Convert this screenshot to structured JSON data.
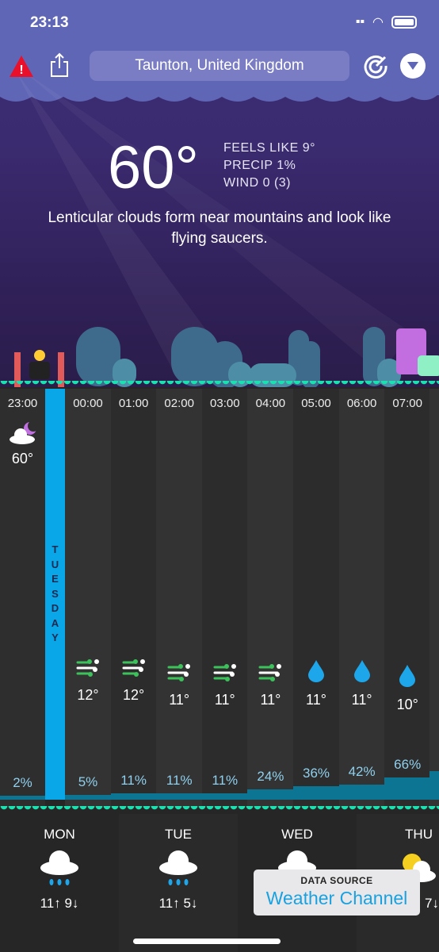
{
  "status": {
    "time": "23:13"
  },
  "header": {
    "location": "Taunton, United Kingdom",
    "icons": [
      "alert-icon",
      "share-icon",
      "radar-icon",
      "dropdown-icon"
    ]
  },
  "current": {
    "temp": "60°",
    "feels_like": "FEELS LIKE 9°",
    "precip": "PRECIP 1%",
    "wind": "WIND 0 (3)",
    "fact": "Lenticular clouds form near mountains and look like flying saucers."
  },
  "hourly": {
    "day_marker": "TUESDAY",
    "now": {
      "time": "23:00",
      "icon": "moon-cloud-icon",
      "temp": "60°",
      "precip": "2%",
      "precip_value": 2
    },
    "hours": [
      {
        "time": "00:00",
        "icon": "wind-icon",
        "temp": "12°",
        "precip": "5%",
        "precip_value": 5
      },
      {
        "time": "01:00",
        "icon": "wind-icon",
        "temp": "12°",
        "precip": "11%",
        "precip_value": 11
      },
      {
        "time": "02:00",
        "icon": "wind-icon",
        "temp": "11°",
        "precip": "11%",
        "precip_value": 11
      },
      {
        "time": "03:00",
        "icon": "wind-icon",
        "temp": "11°",
        "precip": "11%",
        "precip_value": 11
      },
      {
        "time": "04:00",
        "icon": "wind-icon",
        "temp": "11°",
        "precip": "24%",
        "precip_value": 24
      },
      {
        "time": "05:00",
        "icon": "raindrop-icon",
        "temp": "11°",
        "precip": "36%",
        "precip_value": 36
      },
      {
        "time": "06:00",
        "icon": "raindrop-icon",
        "temp": "11°",
        "precip": "42%",
        "precip_value": 42
      },
      {
        "time": "07:00",
        "icon": "raindrop-icon",
        "temp": "10°",
        "precip": "66%",
        "precip_value": 66
      }
    ]
  },
  "daily": [
    {
      "day": "MON",
      "icon": "rain-cloud-icon",
      "temps": "11↑ 9↓"
    },
    {
      "day": "TUE",
      "icon": "rain-cloud-icon",
      "temps": "11↑ 5↓"
    },
    {
      "day": "WED",
      "icon": "rain-cloud-icon",
      "temps": ""
    },
    {
      "day": "THU",
      "icon": "partly-sunny-icon",
      "temps": "7↓"
    }
  ],
  "data_source": {
    "label": "DATA SOURCE",
    "name": "Weather Channel"
  },
  "colors": {
    "accent": "#09a6e8",
    "wave": "#18e3b0",
    "header": "#6066b6"
  }
}
